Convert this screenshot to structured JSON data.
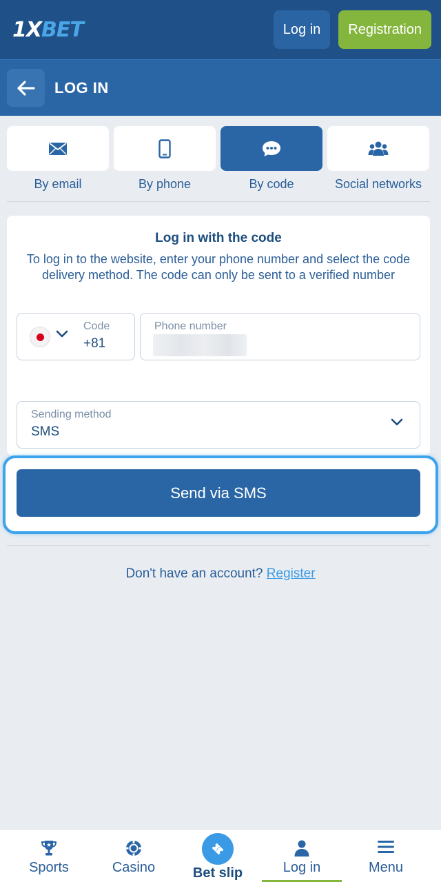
{
  "header": {
    "logo_prefix": "1X",
    "logo_suffix": "BET",
    "login_label": "Log in",
    "registration_label": "Registration"
  },
  "titlebar": {
    "title": "LOG IN",
    "back_icon": "arrow-left-icon"
  },
  "tabs": [
    {
      "label": "By email",
      "icon": "envelope-icon",
      "active": false
    },
    {
      "label": "By phone",
      "icon": "phone-icon",
      "active": false
    },
    {
      "label": "By code",
      "icon": "chat-bubble-icon",
      "active": true
    },
    {
      "label": "Social networks",
      "icon": "users-icon",
      "active": false
    }
  ],
  "form": {
    "title": "Log in with the code",
    "description": "To log in to the website, enter your phone number and select the code delivery method. The code can only be sent to a verified number",
    "code_label": "Code",
    "code_value": "+81",
    "phone_label": "Phone number",
    "method_label": "Sending method",
    "method_value": "SMS",
    "send_label": "Send via SMS"
  },
  "footer": {
    "question": "Don't have an account?",
    "register_link": "Register"
  },
  "bottom_nav": [
    {
      "label": "Sports",
      "icon": "trophy-icon"
    },
    {
      "label": "Casino",
      "icon": "casino-chip-icon"
    },
    {
      "label": "Bet slip",
      "icon": "ticket-icon"
    },
    {
      "label": "Log in",
      "icon": "user-icon"
    },
    {
      "label": "Menu",
      "icon": "hamburger-icon"
    }
  ],
  "colors": {
    "header_bg": "#1f5188",
    "primary": "#2a66a6",
    "registration": "#84b53d",
    "link": "#3a9ae6",
    "page_bg": "#e9edf2"
  }
}
